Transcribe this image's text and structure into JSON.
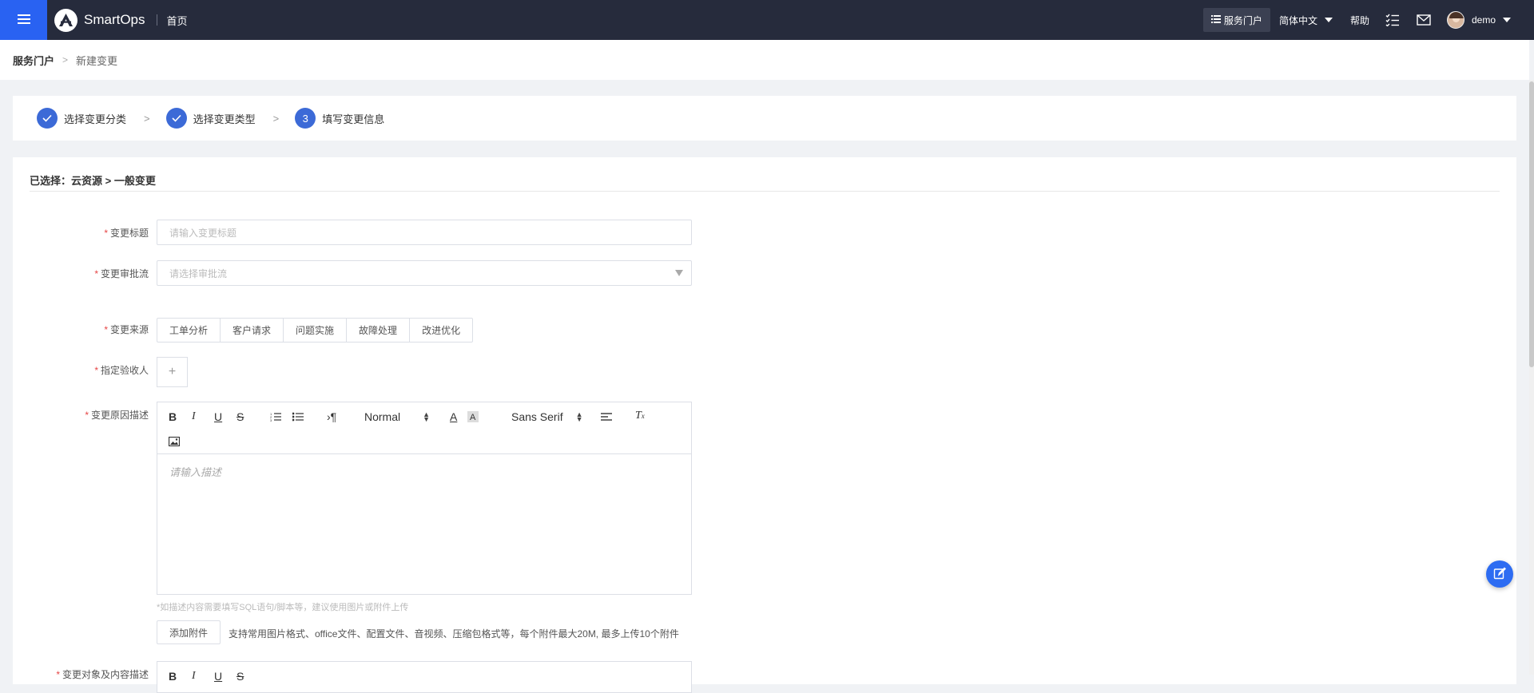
{
  "topbar": {
    "menu_icon": "hamburger-icon",
    "logo_icon": "smartops-logo",
    "app_name": "SmartOps",
    "home_link": "首页",
    "portal_button": "服务门户",
    "language": "简体中文",
    "help": "帮助",
    "todo_icon": "task-list-icon",
    "mail_icon": "mail-icon",
    "user_name": "demo"
  },
  "breadcrumb": {
    "root": "服务门户",
    "current": "新建变更"
  },
  "steps": [
    {
      "label": "选择变更分类",
      "state": "done"
    },
    {
      "label": "选择变更类型",
      "state": "done"
    },
    {
      "label": "填写变更信息",
      "state": "active",
      "number": "3"
    }
  ],
  "form": {
    "selected_path": "已选择：云资源 > 一般变更",
    "title_label": "变更标题",
    "title_placeholder": "请输入变更标题",
    "approval_label": "变更审批流",
    "approval_placeholder": "请选择审批流",
    "source_label": "变更来源",
    "source_options": [
      "工单分析",
      "客户请求",
      "问题实施",
      "故障处理",
      "改进优化"
    ],
    "acceptor_label": "指定验收人",
    "acceptor_add": "+",
    "reason_label": "变更原因描述",
    "editor_font_size": "Normal",
    "editor_font_family": "Sans Serif",
    "reason_placeholder": "请输入描述",
    "hint": "*如描述内容需要填写SQL语句/脚本等，建议使用图片或附件上传",
    "attach_button": "添加附件",
    "attach_note": "支持常用图片格式、office文件、配置文件、音视频、压缩包格式等，每个附件最大20M, 最多上传10个附件",
    "object_label": "变更对象及内容描述"
  },
  "colors": {
    "topbar_bg": "#262b3c",
    "menu_blue": "#2962f2",
    "step_blue": "#3c6ad7",
    "required_red": "#e64545"
  }
}
